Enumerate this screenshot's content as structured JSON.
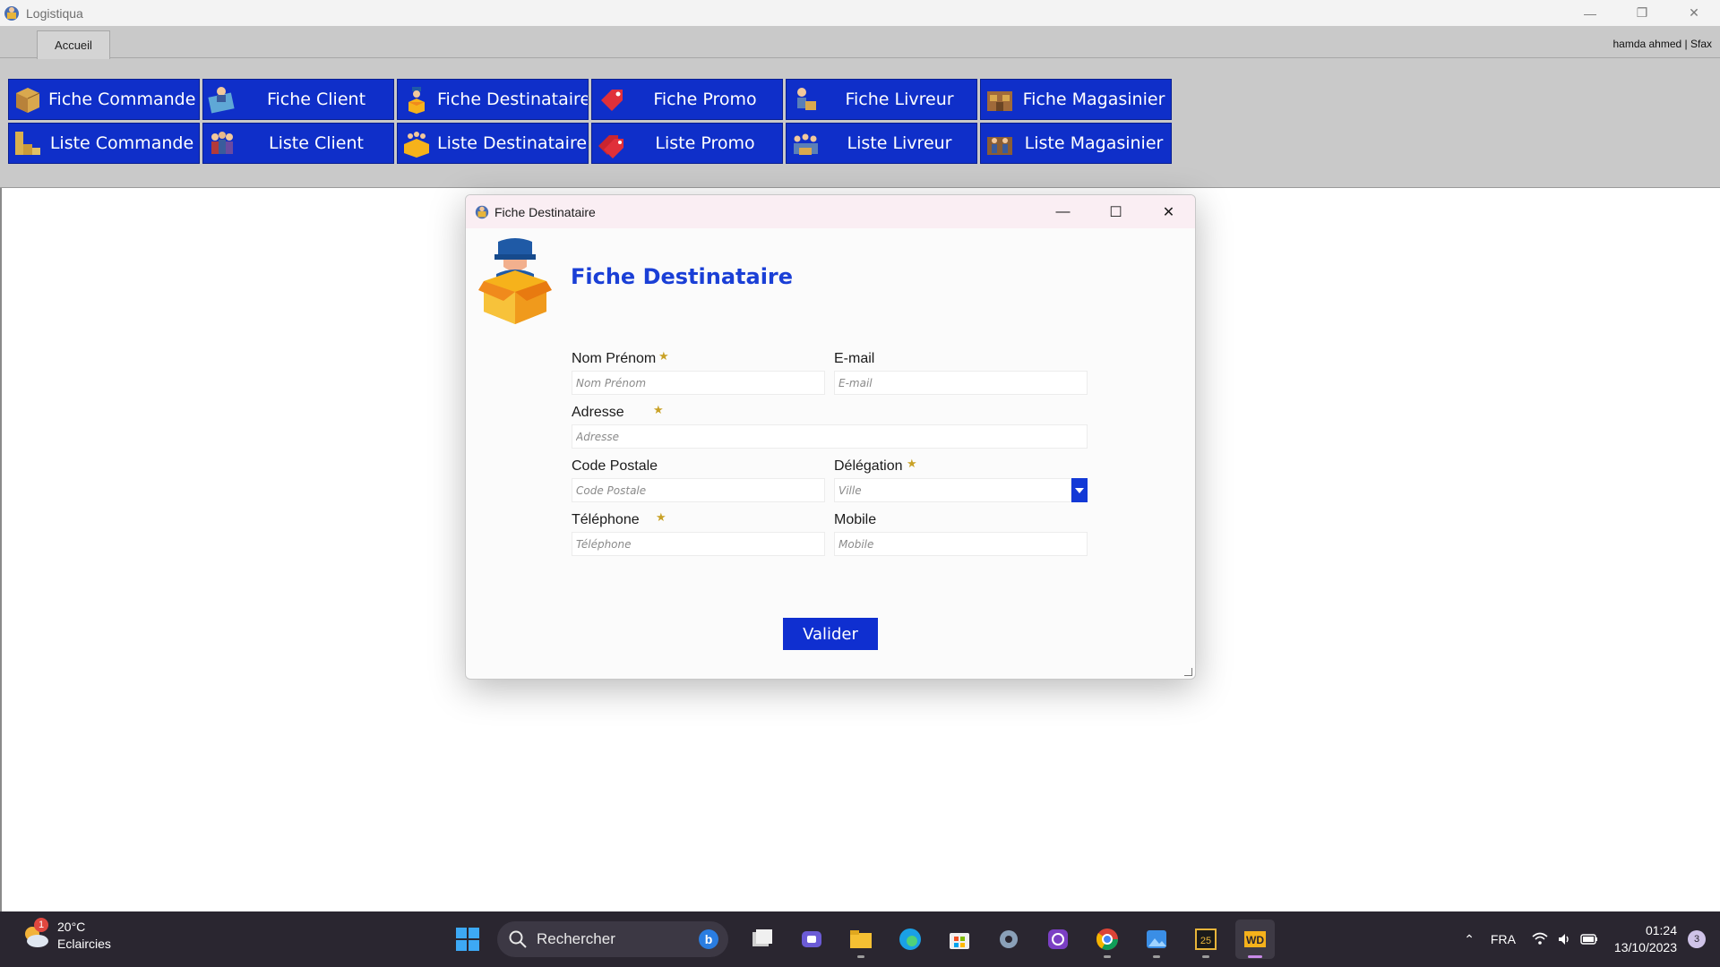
{
  "window": {
    "title": "Logistiqua",
    "minimize": "—",
    "restore": "❐",
    "close": "✕"
  },
  "ribbon": {
    "tab": "Accueil",
    "user": "hamda ahmed | Sfax",
    "buttons": [
      {
        "label": "Fiche Commande",
        "icon": "box-icon"
      },
      {
        "label": "Fiche Client",
        "icon": "client-card-icon"
      },
      {
        "label": "Fiche Destinataire",
        "icon": "recipient-icon"
      },
      {
        "label": "Fiche Promo",
        "icon": "promo-tag-icon"
      },
      {
        "label": "Fiche Livreur",
        "icon": "delivery-man-icon"
      },
      {
        "label": "Fiche Magasinier",
        "icon": "warehouse-icon"
      },
      {
        "label": "Liste Commande",
        "icon": "boxes-icon"
      },
      {
        "label": "Liste Client",
        "icon": "clients-group-icon"
      },
      {
        "label": "Liste Destinataire",
        "icon": "recipients-icon"
      },
      {
        "label": "Liste Promo",
        "icon": "promo-tags-icon"
      },
      {
        "label": "Liste Livreur",
        "icon": "delivery-men-icon"
      },
      {
        "label": "Liste Magasinier",
        "icon": "warehouse-workers-icon"
      }
    ]
  },
  "dialog": {
    "title": "Fiche Destinataire",
    "heading": "Fiche Destinataire",
    "minimize": "—",
    "maximize": "☐",
    "close": "✕",
    "fields": {
      "nom": {
        "label": "Nom Prénom",
        "placeholder": "Nom Prénom",
        "required": true,
        "value": ""
      },
      "email": {
        "label": "E-mail",
        "placeholder": "E-mail",
        "required": false,
        "value": ""
      },
      "adresse": {
        "label": "Adresse",
        "placeholder": "Adresse",
        "required": true,
        "value": ""
      },
      "code_postale": {
        "label": "Code Postale",
        "placeholder": "Code Postale",
        "required": false,
        "value": ""
      },
      "delegation": {
        "label": "Délégation",
        "placeholder": "Ville",
        "required": true,
        "value": ""
      },
      "telephone": {
        "label": "Téléphone",
        "placeholder": "Téléphone",
        "required": true,
        "value": ""
      },
      "mobile": {
        "label": "Mobile",
        "placeholder": "Mobile",
        "required": false,
        "value": ""
      }
    },
    "required_mark": "★",
    "submit_label": "Valider"
  },
  "taskbar": {
    "weather": {
      "temp": "20°C",
      "condition": "Eclaircies",
      "badge": "1"
    },
    "search_placeholder": "Rechercher",
    "apps": [
      "task-view-icon",
      "teams-icon",
      "file-explorer-icon",
      "edge-icon",
      "store-icon",
      "settings-icon",
      "proton-icon",
      "chrome-icon",
      "photos-icon",
      "app-studio-icon",
      "windev-icon"
    ],
    "language": "FRA",
    "time": "01:24",
    "date": "13/10/2023",
    "notifications": "3"
  },
  "colors": {
    "ribbon_button": "#0f2fc9",
    "heading": "#1a3fd6",
    "ribbon_bg": "#c9c9c9",
    "required_star": "#c9a227"
  }
}
